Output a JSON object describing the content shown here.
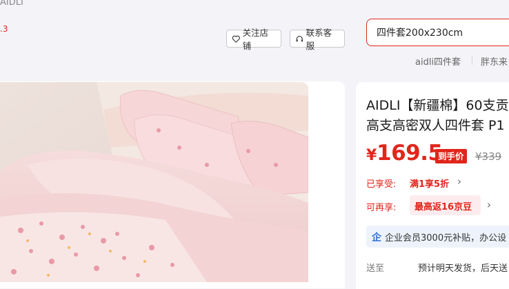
{
  "breadcrumb": {
    "text": "AIDLI"
  },
  "store": {
    "rating_fragment": ".3"
  },
  "header": {
    "follow_label": "关注店铺",
    "service_label": "联系客服"
  },
  "search": {
    "value": "四件套200x230cm",
    "hot_terms": [
      "aidli四件套",
      "胖东来"
    ]
  },
  "product": {
    "title_line1": "AIDLI【新疆棉】60支贡",
    "title_line2": "高支高密双人四件套 P1",
    "currency": "¥",
    "price": "169.5",
    "price_tag": "到手价",
    "original_price": "¥339",
    "promo_label_1": "已享受:",
    "promo_value_1": "满1享5折",
    "promo_label_2": "可再享:",
    "promo_value_2": "最高返16京豆",
    "member_text": "企业会员3000元补贴，办公设",
    "shipping_label": "送至",
    "shipping_value": "预计明天发货，后天送"
  },
  "icons": {
    "chevron": "›",
    "member": "企"
  }
}
